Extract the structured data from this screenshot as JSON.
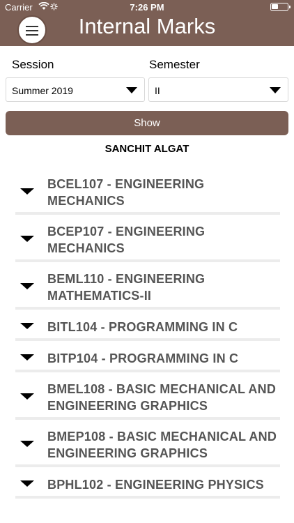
{
  "status_bar": {
    "carrier": "Carrier",
    "time": "7:26 PM",
    "icons": [
      "wifi-icon",
      "activity-spinner-icon",
      "battery-icon"
    ]
  },
  "header": {
    "title": "Internal Marks",
    "menu_icon": "hamburger-menu-icon",
    "background": "#7b5f55"
  },
  "filters": {
    "session_label": "Session",
    "session_value": "Summer 2019",
    "semester_label": "Semester",
    "semester_value": "II"
  },
  "show_button": {
    "label": "Show",
    "color": "#7b5f55"
  },
  "student_name": "SANCHIT ALGAT",
  "subjects": [
    "BCEL107 - ENGINEERING MECHANICS",
    "BCEP107 - ENGINEERING MECHANICS",
    "BEML110 - ENGINEERING MATHEMATICS-II",
    "BITL104 - PROGRAMMING IN C",
    "BITP104 - PROGRAMMING IN C",
    "BMEL108 - BASIC MECHANICAL AND ENGINEERING GRAPHICS",
    "BMEP108 - BASIC MECHANICAL AND ENGINEERING GRAPHICS",
    "BPHL102 - ENGINEERING PHYSICS"
  ]
}
